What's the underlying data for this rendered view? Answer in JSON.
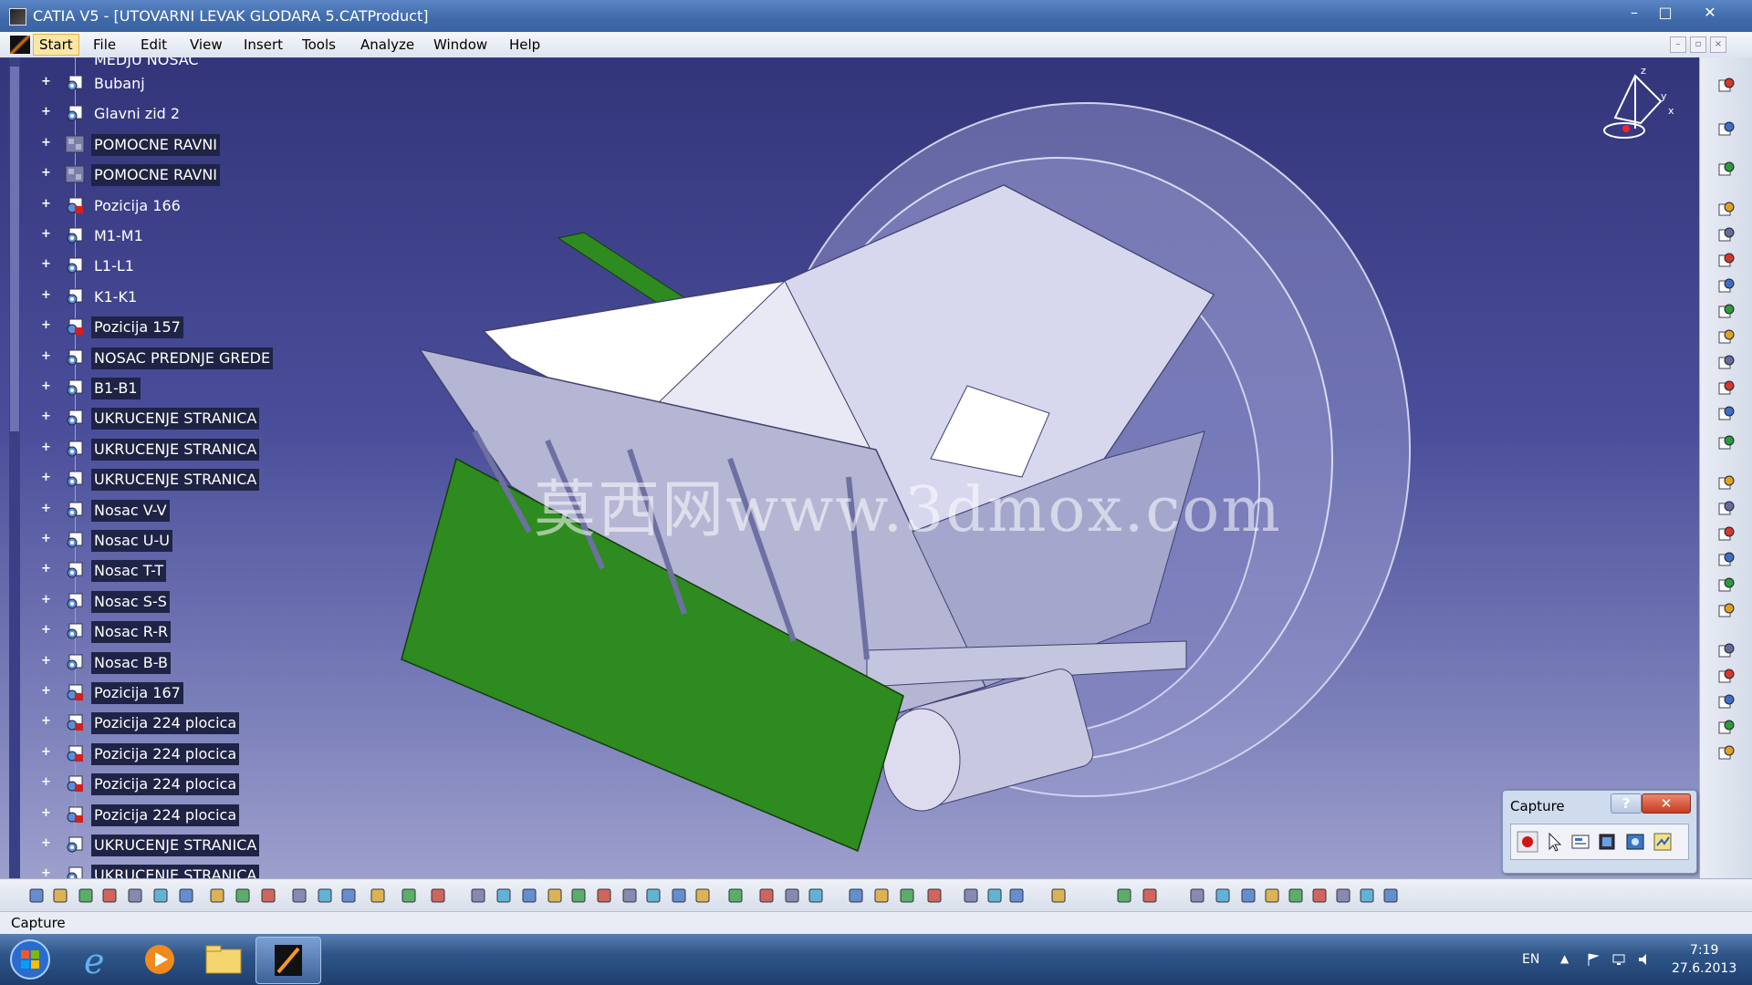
{
  "window": {
    "title": "CATIA V5 - [UTOVARNI LEVAK GLODARA 5.CATProduct]",
    "minimize": "–",
    "maximize": "□",
    "close": "✕"
  },
  "menu": {
    "items": [
      "Start",
      "File",
      "Edit",
      "View",
      "Insert",
      "Tools",
      "Analyze",
      "Window",
      "Help"
    ],
    "active": "Start"
  },
  "tree": {
    "partial_top": "MEDJU NOSAC",
    "items": [
      {
        "label": "Bubanj",
        "icon": "part-icon",
        "selected": false
      },
      {
        "label": "Glavni zid 2",
        "icon": "part-icon",
        "selected": false
      },
      {
        "label": "POMOCNE RAVNI",
        "icon": "plane-group-icon",
        "selected": true
      },
      {
        "label": "POMOCNE RAVNI",
        "icon": "plane-group-icon",
        "selected": true
      },
      {
        "label": "Pozicija 166",
        "icon": "part-red-icon",
        "selected": false
      },
      {
        "label": "M1-M1",
        "icon": "part-icon",
        "selected": false
      },
      {
        "label": "L1-L1",
        "icon": "part-icon",
        "selected": false
      },
      {
        "label": "K1-K1",
        "icon": "part-icon",
        "selected": false
      },
      {
        "label": "Pozicija 157",
        "icon": "part-red-icon",
        "selected": true
      },
      {
        "label": "NOSAC PREDNJE GREDE",
        "icon": "part-icon",
        "selected": true
      },
      {
        "label": "B1-B1",
        "icon": "part-icon",
        "selected": true
      },
      {
        "label": "UKRUCENJE STRANICA",
        "icon": "part-icon",
        "selected": true
      },
      {
        "label": "UKRUCENJE STRANICA",
        "icon": "part-icon",
        "selected": true
      },
      {
        "label": "UKRUCENJE STRANICA",
        "icon": "part-icon",
        "selected": true
      },
      {
        "label": "Nosac V-V",
        "icon": "part-icon",
        "selected": true
      },
      {
        "label": "Nosac U-U",
        "icon": "part-icon",
        "selected": true
      },
      {
        "label": "Nosac T-T",
        "icon": "part-icon",
        "selected": true
      },
      {
        "label": "Nosac S-S",
        "icon": "part-icon",
        "selected": true
      },
      {
        "label": "Nosac R-R",
        "icon": "part-icon",
        "selected": true
      },
      {
        "label": "Nosac B-B",
        "icon": "part-icon",
        "selected": true
      },
      {
        "label": "Pozicija 167",
        "icon": "part-red-icon",
        "selected": true
      },
      {
        "label": "Pozicija 224 plocica",
        "icon": "part-red-icon",
        "selected": true
      },
      {
        "label": "Pozicija 224 plocica",
        "icon": "part-red-icon",
        "selected": true
      },
      {
        "label": "Pozicija 224 plocica",
        "icon": "part-red-icon",
        "selected": true
      },
      {
        "label": "Pozicija 224 plocica",
        "icon": "part-red-icon",
        "selected": true
      },
      {
        "label": "UKRUCENJE STRANICA",
        "icon": "part-icon",
        "selected": true
      },
      {
        "label": "UKRUCENJE STRANICA",
        "icon": "part-icon",
        "selected": true
      }
    ]
  },
  "compass_axes": {
    "x": "x",
    "y": "y",
    "z": "z"
  },
  "watermark": "莫西网www.3dmox.com",
  "capture_dialog": {
    "title": "Capture",
    "help": "?",
    "close": "✕",
    "tools": [
      "record-icon",
      "select-icon",
      "options-icon",
      "album-icon",
      "capture-icon",
      "save-icon"
    ]
  },
  "status": {
    "text": "Capture"
  },
  "taskbar": {
    "items": [
      "start-orb",
      "internet-explorer-icon",
      "media-player-icon",
      "explorer-icon",
      "catia-icon"
    ],
    "active": "catia-icon",
    "lang": "EN",
    "time": "7:19",
    "date": "27.6.2013"
  },
  "colors": {
    "viewport_top": "#33357a",
    "viewport_bottom": "#9da0cc",
    "green_part": "#2e8b1f",
    "selection": "#1f2446"
  }
}
